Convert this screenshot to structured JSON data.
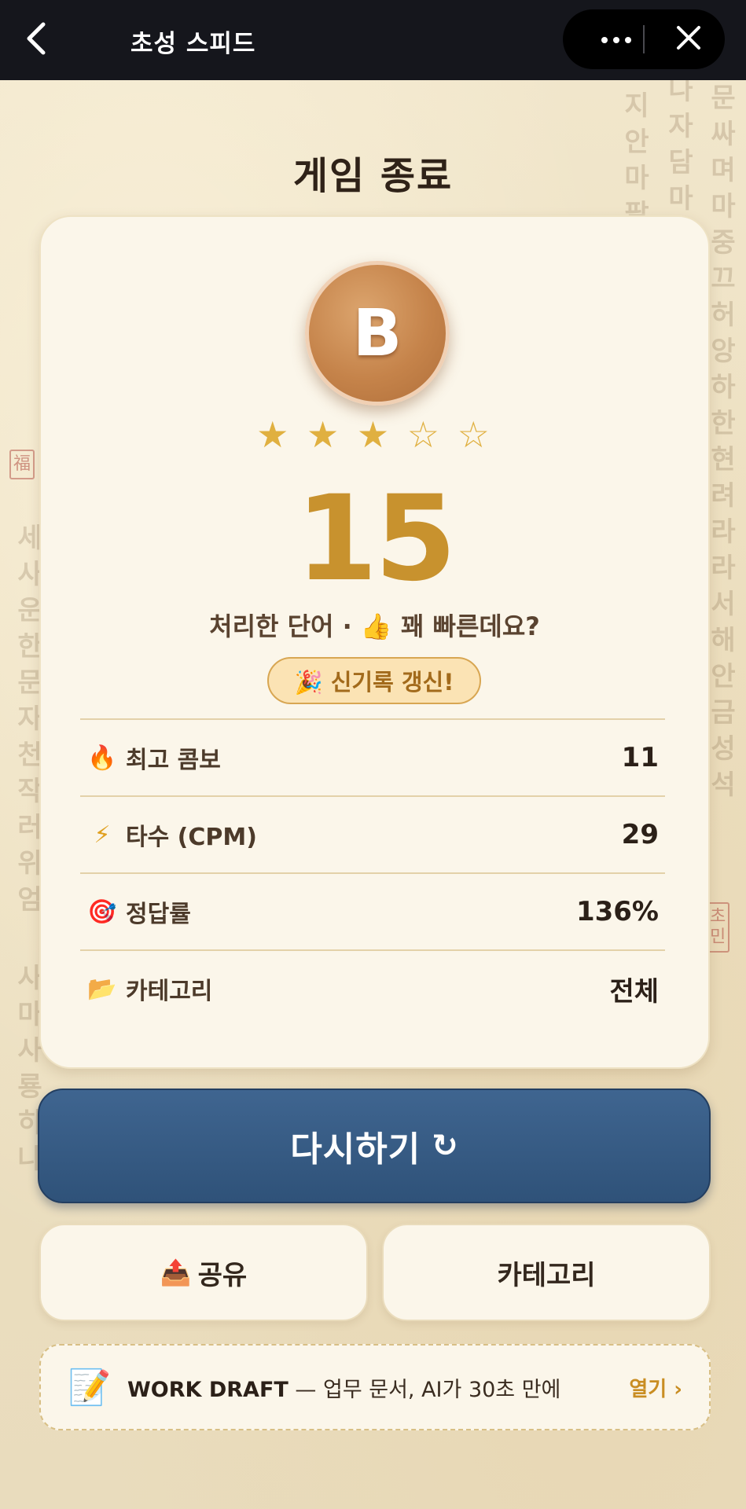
{
  "header": {
    "title": "초성 스피드",
    "back_icon": "chevron-left-icon",
    "more_icon": "more-horizontal-icon",
    "close_icon": "close-icon"
  },
  "page": {
    "title": "게임 종료"
  },
  "result": {
    "grade": "B",
    "stars": {
      "filled": 3,
      "total": 5
    },
    "score": "15",
    "caption": "처리한 단어 · 👍 꽤 빠른데요?",
    "record_badge": "🎉 신기록 갱신!",
    "stats": [
      {
        "icon": "🔥",
        "label": "최고 콤보",
        "value": "11"
      },
      {
        "icon": "⚡",
        "label": "타수 (CPM)",
        "value": "29"
      },
      {
        "icon": "🎯",
        "label": "정답률",
        "value": "136%"
      },
      {
        "icon": "📂",
        "label": "카테고리",
        "value": "전체"
      }
    ]
  },
  "actions": {
    "retry_label": "다시하기",
    "retry_icon": "↻",
    "share_icon": "📤",
    "share_label": "공유",
    "category_label": "카테고리"
  },
  "ad": {
    "icon": "📝",
    "brand": "WORK DRAFT",
    "text": " — 업무 문서, AI가 30초 만에",
    "open_label": "열기 ›"
  },
  "colors": {
    "accent_gold": "#c8922e",
    "retry_blue": "#2f5279",
    "grade_bronze": "#c5834a",
    "topbar": "#15161c"
  }
}
